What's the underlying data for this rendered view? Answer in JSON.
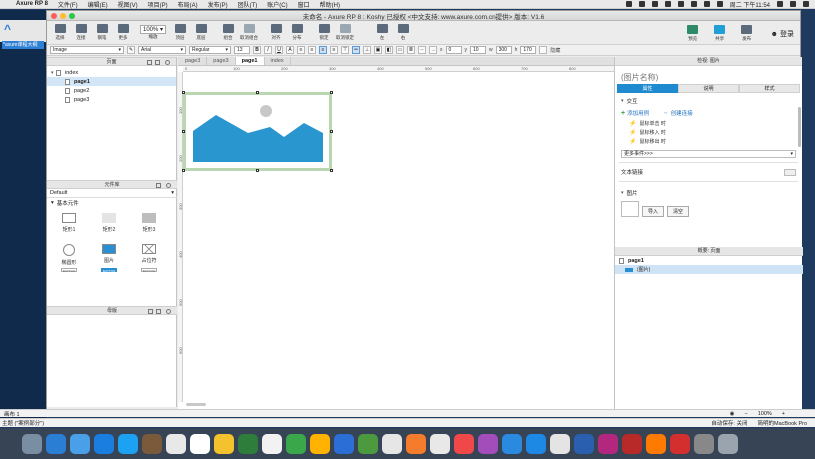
{
  "menubar": {
    "app_name": "Axure RP 8",
    "items": [
      "文件(F)",
      "编辑(E)",
      "视图(V)",
      "项目(P)",
      "布局(A)",
      "发布(P)",
      "团队(T)",
      "账户(C)",
      "窗口",
      "帮助(H)"
    ],
    "clock": "周二 下午11:54"
  },
  "desktop": {
    "selected_label": "*axure课程大纲"
  },
  "window": {
    "title": "未命名 - Axure RP 8 : Koshy 已授权    <中文支持: www.axure.com.cn提供> 版本: V1.6"
  },
  "toolbar": {
    "buttons": [
      "选择",
      "连接",
      "钢笔",
      "更多"
    ],
    "zoom": "100%",
    "zoom_label": "缩放",
    "buttons2": [
      "顶层",
      "底层",
      "组合",
      "取消组合",
      "对齐",
      "分布",
      "锁定",
      "取消锁定",
      "左",
      "右"
    ],
    "preview": "预览",
    "share": "共享",
    "publish": "发布",
    "login": "登录"
  },
  "formatbar": {
    "widget_type": "Image",
    "font": "Arial",
    "weight": "Regular",
    "size": "13",
    "x_label": "x",
    "x": "0",
    "y_label": "y",
    "y": "10",
    "w_label": "w",
    "w": "300",
    "h_label": "h",
    "h": "170",
    "hidden_label": "隐藏"
  },
  "pages_panel": {
    "title": "页面",
    "items": [
      {
        "label": "index",
        "level": 0,
        "selected": false
      },
      {
        "label": "page1",
        "level": 1,
        "selected": true
      },
      {
        "label": "page2",
        "level": 1,
        "selected": false
      },
      {
        "label": "page3",
        "level": 1,
        "selected": false
      }
    ]
  },
  "library_panel": {
    "title": "元件库",
    "selected_library": "Default",
    "section": "基本元件",
    "widgets": [
      {
        "label": "矩形1",
        "shape": "rect1"
      },
      {
        "label": "矩形2",
        "shape": "rect2"
      },
      {
        "label": "矩形3",
        "shape": "rect3"
      },
      {
        "label": "椭圆形",
        "shape": "ell"
      },
      {
        "label": "图片",
        "shape": "img"
      },
      {
        "label": "占位符",
        "shape": "ph"
      }
    ],
    "buttons": [
      "BUTTON",
      "BUTTON",
      "BUTTON"
    ]
  },
  "masters_panel": {
    "title": "母版"
  },
  "canvas": {
    "tabs": [
      {
        "label": "page3",
        "active": false
      },
      {
        "label": "page3",
        "active": false
      },
      {
        "label": "page1",
        "active": true
      },
      {
        "label": "index",
        "active": false
      }
    ],
    "ruler_h": [
      "0",
      "100",
      "200",
      "300",
      "400",
      "500",
      "600",
      "700",
      "800"
    ],
    "ruler_v": [
      "100",
      "200",
      "300",
      "400",
      "500",
      "600"
    ],
    "image_colors": {
      "mountain": "#2a96cf",
      "sun": "#c8c8c8",
      "frame": "#b9d7b1"
    }
  },
  "inspector": {
    "title": "检视: 图片",
    "widget_name_placeholder": "(图片名称)",
    "tabs": [
      {
        "label": "属性",
        "active": true
      },
      {
        "label": "说明",
        "active": false
      },
      {
        "label": "样式",
        "active": false
      }
    ],
    "interaction_title": "交互",
    "add_case": "添加用例",
    "create_link": "创建连接",
    "events": [
      "鼠标单击 时",
      "鼠标移入 时",
      "鼠标移出 时"
    ],
    "more_events": "更多事件>>>",
    "text_link": "文本链接",
    "image_section": "图片",
    "import_btn": "导入",
    "clear_btn": "清空"
  },
  "outline": {
    "title": "概要: 页面",
    "page": "page1",
    "item": "(图片)"
  },
  "status": {
    "canvas_label": "画布 1",
    "zoom": "100%",
    "theme": "主题 (\"案例部分\")",
    "autosave": "自动保存: 关闭",
    "machine": "简明的MacBook Pro"
  },
  "dock": {
    "colors": [
      "#7a8ea3",
      "#2a7fd4",
      "#4aa0e8",
      "#1a7ee0",
      "#1da1f2",
      "#7a5a3a",
      "#e8e8e8",
      "#ffffff",
      "#f3c22c",
      "#2f7d3a",
      "#f2f2f2",
      "#3aa84a",
      "#ffb300",
      "#2b6fd6",
      "#4c9a3d",
      "#e6e6e6",
      "#f47c2b",
      "#e8e8e8",
      "#f04848",
      "#a34dbb",
      "#2a8ae0",
      "#1e88e5",
      "#e4e4e4",
      "#2a5fb0",
      "#b3277e",
      "#b82a2a",
      "#ff7a00",
      "#d32f2f",
      "#888888",
      "#9aa4ae",
      "#b0b8c0"
    ]
  }
}
